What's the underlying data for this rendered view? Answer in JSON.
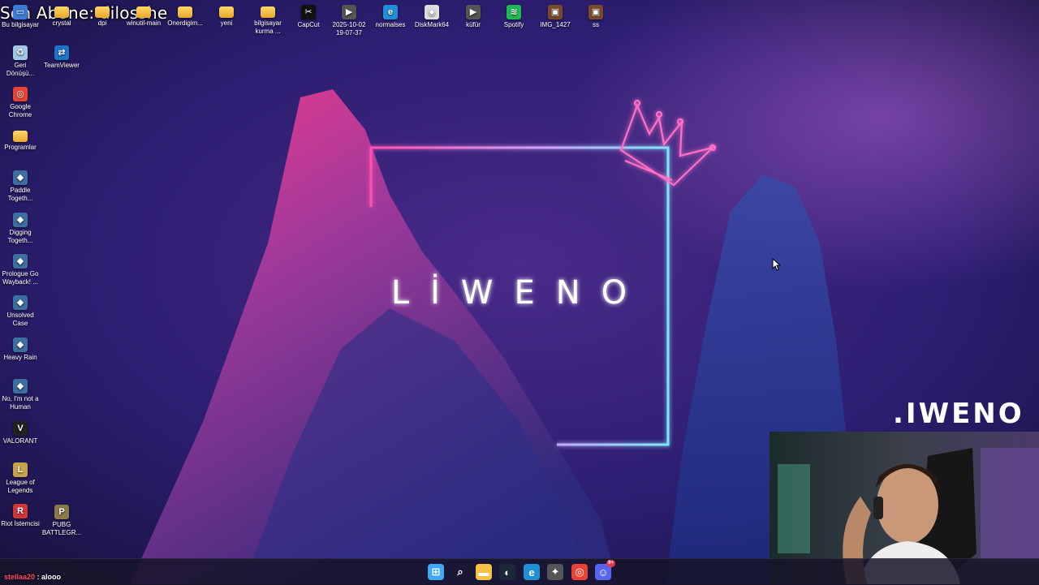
{
  "overlay": {
    "subscriber_text": "Son Abone: dilosshe",
    "brand": ".IWENO"
  },
  "wallpaper": {
    "title": "LİWENO"
  },
  "desktop_top_row": [
    {
      "label": "Bu bilgisayar",
      "icon": "computer-icon"
    },
    {
      "label": "crystal",
      "icon": "folder-icon"
    },
    {
      "label": "dpi",
      "icon": "folder-icon"
    },
    {
      "label": "winutil-main",
      "icon": "folder-icon"
    },
    {
      "label": "Onerdigim...",
      "icon": "folder-icon"
    },
    {
      "label": "yeni",
      "icon": "folder-icon"
    },
    {
      "label": "bilgisayar kurma ...",
      "icon": "folder-icon"
    },
    {
      "label": "CapCut",
      "icon": "capcut-icon"
    },
    {
      "label": "2025-10-02 19-07-37",
      "icon": "video-file-icon"
    },
    {
      "label": "normalses",
      "icon": "edge-file-icon"
    },
    {
      "label": "DiskMark64",
      "icon": "diskmark-icon"
    },
    {
      "label": "küfür",
      "icon": "video-file-icon"
    },
    {
      "label": "Spotify",
      "icon": "spotify-icon"
    },
    {
      "label": "IMG_1427",
      "icon": "image-file-icon"
    },
    {
      "label": "ss",
      "icon": "image-file-icon"
    }
  ],
  "desktop_left_column": [
    {
      "label": "Geri Dönüşü...",
      "icon": "recycle-bin-icon"
    },
    {
      "label": "Google Chrome",
      "icon": "chrome-icon"
    },
    {
      "label": "Programlar",
      "icon": "folder-icon"
    },
    {
      "label": "Paddle Togeth...",
      "icon": "game-icon"
    },
    {
      "label": "Digging Togeth...",
      "icon": "game-icon"
    },
    {
      "label": "Prologue Go Wayback! ...",
      "icon": "game-icon"
    },
    {
      "label": "Unsolved Case",
      "icon": "game-icon"
    },
    {
      "label": "Heavy Rain",
      "icon": "game-icon"
    },
    {
      "label": "No, I'm not a Human",
      "icon": "game-icon"
    },
    {
      "label": "VALORANT",
      "icon": "valorant-icon"
    },
    {
      "label": "League of Legends",
      "icon": "league-icon"
    },
    {
      "label": "Riot İstemcisi",
      "icon": "riot-icon"
    }
  ],
  "desktop_second_column": [
    {
      "label": "TeamViewer",
      "icon": "teamviewer-icon"
    },
    {
      "label": "PUBG BATTLEGR...",
      "icon": "pubg-icon"
    }
  ],
  "chat": {
    "user": "stellaa20",
    "message": " : alooo"
  },
  "taskbar": {
    "items": [
      {
        "name": "start-button",
        "icon": "windows-icon",
        "color": "#3fa9f5"
      },
      {
        "name": "search-button",
        "icon": "search-icon",
        "color": "#ffffff"
      },
      {
        "name": "file-explorer-button",
        "icon": "folder-icon",
        "color": "#f5c242"
      },
      {
        "name": "steam-button",
        "icon": "steam-icon",
        "color": "#1b2838"
      },
      {
        "name": "edge-button",
        "icon": "edge-icon",
        "color": "#1f8fd6"
      },
      {
        "name": "app-button",
        "icon": "app-icon",
        "color": "#555555"
      },
      {
        "name": "chrome-button",
        "icon": "chrome-icon",
        "color": "#ea4335"
      },
      {
        "name": "discord-button",
        "icon": "discord-icon",
        "color": "#5865f2",
        "badge": "9+"
      }
    ]
  }
}
